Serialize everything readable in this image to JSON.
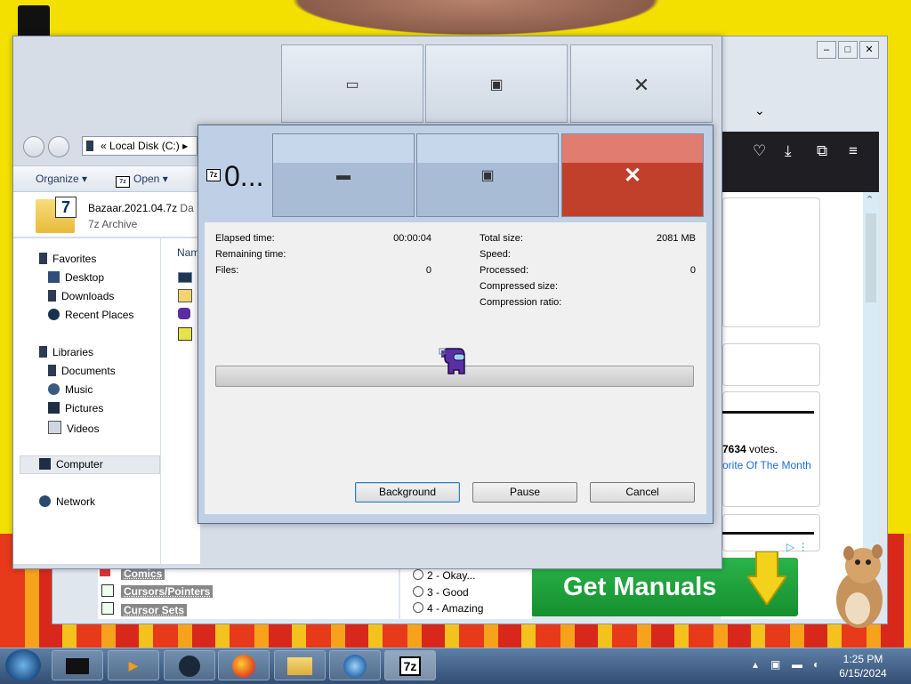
{
  "explorer": {
    "address": "Local Disk (C:)",
    "address_prefix": "«",
    "commands": {
      "organize": "Organize",
      "open": "Open"
    },
    "file_name": "Bazaar.2021.04.7z",
    "file_suffix": "Da",
    "file_type": "7z Archive",
    "name_column": "Nam",
    "nav": {
      "favorites": "Favorites",
      "desktop": "Desktop",
      "downloads": "Downloads",
      "recent": "Recent Places",
      "libraries": "Libraries",
      "documents": "Documents",
      "music": "Music",
      "pictures": "Pictures",
      "videos": "Videos",
      "computer": "Computer",
      "network": "Network"
    }
  },
  "dialog": {
    "title": "0...",
    "elapsed_label": "Elapsed time:",
    "elapsed_value": "00:00:04",
    "remaining_label": "Remaining time:",
    "files_label": "Files:",
    "files_value": "0",
    "total_size_label": "Total size:",
    "total_size_value": "2081 MB",
    "speed_label": "Speed:",
    "processed_label": "Processed:",
    "processed_value": "0",
    "compressed_label": "Compressed size:",
    "ratio_label": "Compression ratio:",
    "progress": 0,
    "buttons": {
      "background": "Background",
      "pause": "Pause",
      "cancel": "Cancel"
    }
  },
  "browser": {
    "votes_number": "7634",
    "votes_text": " votes.",
    "fav_link": "orite Of The Month",
    "ad_text": "Get Manuals",
    "left_links": [
      "Comics",
      "Cursors/Pointers",
      "Cursor Sets"
    ],
    "poll_options": [
      "2 - Okay...",
      "3 - Good",
      "4 - Amazing"
    ]
  },
  "taskbar": {
    "time": "1:25 PM",
    "date": "6/15/2024",
    "active_app": "7z"
  },
  "colors": {
    "dialog_close": "#c1402c",
    "ad_green": "#15902f",
    "desktop_yellow": "#f3e000"
  }
}
